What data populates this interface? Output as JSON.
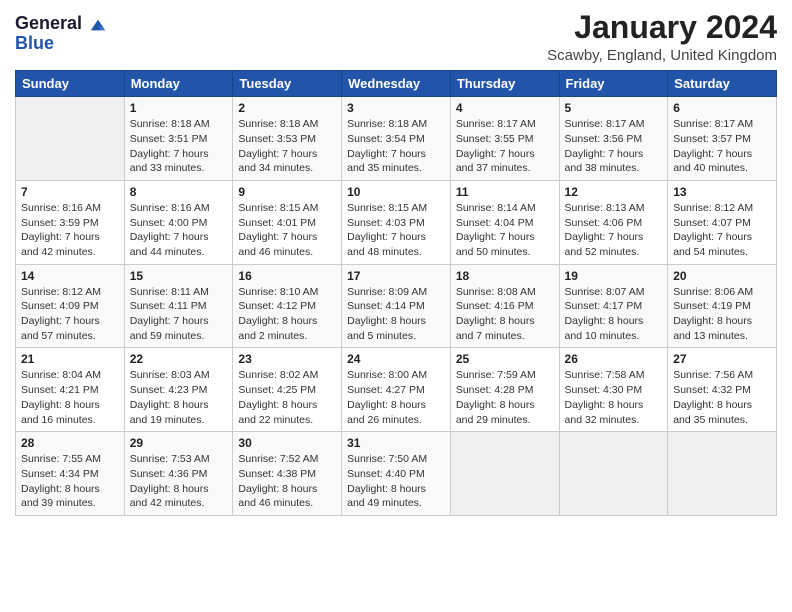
{
  "logo": {
    "line1": "General",
    "line2": "Blue"
  },
  "title": "January 2024",
  "subtitle": "Scawby, England, United Kingdom",
  "days_of_week": [
    "Sunday",
    "Monday",
    "Tuesday",
    "Wednesday",
    "Thursday",
    "Friday",
    "Saturday"
  ],
  "weeks": [
    [
      {
        "day": "",
        "detail": ""
      },
      {
        "day": "1",
        "detail": "Sunrise: 8:18 AM\nSunset: 3:51 PM\nDaylight: 7 hours\nand 33 minutes."
      },
      {
        "day": "2",
        "detail": "Sunrise: 8:18 AM\nSunset: 3:53 PM\nDaylight: 7 hours\nand 34 minutes."
      },
      {
        "day": "3",
        "detail": "Sunrise: 8:18 AM\nSunset: 3:54 PM\nDaylight: 7 hours\nand 35 minutes."
      },
      {
        "day": "4",
        "detail": "Sunrise: 8:17 AM\nSunset: 3:55 PM\nDaylight: 7 hours\nand 37 minutes."
      },
      {
        "day": "5",
        "detail": "Sunrise: 8:17 AM\nSunset: 3:56 PM\nDaylight: 7 hours\nand 38 minutes."
      },
      {
        "day": "6",
        "detail": "Sunrise: 8:17 AM\nSunset: 3:57 PM\nDaylight: 7 hours\nand 40 minutes."
      }
    ],
    [
      {
        "day": "7",
        "detail": ""
      },
      {
        "day": "8",
        "detail": "Sunrise: 8:16 AM\nSunset: 4:00 PM\nDaylight: 7 hours\nand 44 minutes."
      },
      {
        "day": "9",
        "detail": "Sunrise: 8:15 AM\nSunset: 4:01 PM\nDaylight: 7 hours\nand 46 minutes."
      },
      {
        "day": "10",
        "detail": "Sunrise: 8:15 AM\nSunset: 4:03 PM\nDaylight: 7 hours\nand 48 minutes."
      },
      {
        "day": "11",
        "detail": "Sunrise: 8:14 AM\nSunset: 4:04 PM\nDaylight: 7 hours\nand 50 minutes."
      },
      {
        "day": "12",
        "detail": "Sunrise: 8:13 AM\nSunset: 4:06 PM\nDaylight: 7 hours\nand 52 minutes."
      },
      {
        "day": "13",
        "detail": "Sunrise: 8:12 AM\nSunset: 4:07 PM\nDaylight: 7 hours\nand 54 minutes."
      }
    ],
    [
      {
        "day": "14",
        "detail": ""
      },
      {
        "day": "15",
        "detail": "Sunrise: 8:11 AM\nSunset: 4:11 PM\nDaylight: 7 hours\nand 59 minutes."
      },
      {
        "day": "16",
        "detail": "Sunrise: 8:10 AM\nSunset: 4:12 PM\nDaylight: 8 hours\nand 2 minutes."
      },
      {
        "day": "17",
        "detail": "Sunrise: 8:09 AM\nSunset: 4:14 PM\nDaylight: 8 hours\nand 5 minutes."
      },
      {
        "day": "18",
        "detail": "Sunrise: 8:08 AM\nSunset: 4:16 PM\nDaylight: 8 hours\nand 7 minutes."
      },
      {
        "day": "19",
        "detail": "Sunrise: 8:07 AM\nSunset: 4:17 PM\nDaylight: 8 hours\nand 10 minutes."
      },
      {
        "day": "20",
        "detail": "Sunrise: 8:06 AM\nSunset: 4:19 PM\nDaylight: 8 hours\nand 13 minutes."
      }
    ],
    [
      {
        "day": "21",
        "detail": ""
      },
      {
        "day": "22",
        "detail": "Sunrise: 8:03 AM\nSunset: 4:23 PM\nDaylight: 8 hours\nand 19 minutes."
      },
      {
        "day": "23",
        "detail": "Sunrise: 8:02 AM\nSunset: 4:25 PM\nDaylight: 8 hours\nand 22 minutes."
      },
      {
        "day": "24",
        "detail": "Sunrise: 8:00 AM\nSunset: 4:27 PM\nDaylight: 8 hours\nand 26 minutes."
      },
      {
        "day": "25",
        "detail": "Sunrise: 7:59 AM\nSunset: 4:28 PM\nDaylight: 8 hours\nand 29 minutes."
      },
      {
        "day": "26",
        "detail": "Sunrise: 7:58 AM\nSunset: 4:30 PM\nDaylight: 8 hours\nand 32 minutes."
      },
      {
        "day": "27",
        "detail": "Sunrise: 7:56 AM\nSunset: 4:32 PM\nDaylight: 8 hours\nand 35 minutes."
      }
    ],
    [
      {
        "day": "28",
        "detail": "Sunrise: 7:55 AM\nSunset: 4:34 PM\nDaylight: 8 hours\nand 39 minutes."
      },
      {
        "day": "29",
        "detail": "Sunrise: 7:53 AM\nSunset: 4:36 PM\nDaylight: 8 hours\nand 42 minutes."
      },
      {
        "day": "30",
        "detail": "Sunrise: 7:52 AM\nSunset: 4:38 PM\nDaylight: 8 hours\nand 46 minutes."
      },
      {
        "day": "31",
        "detail": "Sunrise: 7:50 AM\nSunset: 4:40 PM\nDaylight: 8 hours\nand 49 minutes."
      },
      {
        "day": "",
        "detail": ""
      },
      {
        "day": "",
        "detail": ""
      },
      {
        "day": "",
        "detail": ""
      }
    ]
  ],
  "week1_sunday_detail": "Sunrise: 8:16 AM\nSunset: 3:59 PM\nDaylight: 7 hours\nand 42 minutes.",
  "week3_sunday_detail": "Sunrise: 8:12 AM\nSunset: 4:09 PM\nDaylight: 7 hours\nand 57 minutes.",
  "week4_sunday_detail": "Sunrise: 8:04 AM\nSunset: 4:21 PM\nDaylight: 8 hours\nand 16 minutes."
}
